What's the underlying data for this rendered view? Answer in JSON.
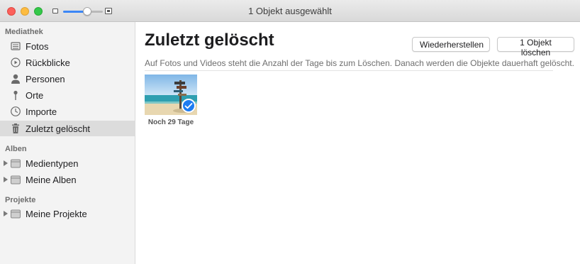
{
  "window": {
    "title": "1 Objekt ausgewählt",
    "zoom_level": 0.6
  },
  "sidebar": {
    "sections": [
      {
        "header": "Mediathek"
      },
      {
        "header": "Alben"
      },
      {
        "header": "Projekte"
      }
    ],
    "library_items": [
      {
        "label": "Fotos",
        "icon": "photos-icon"
      },
      {
        "label": "Rückblicke",
        "icon": "memories-icon"
      },
      {
        "label": "Personen",
        "icon": "person-icon"
      },
      {
        "label": "Orte",
        "icon": "pin-icon"
      },
      {
        "label": "Importe",
        "icon": "clock-icon"
      },
      {
        "label": "Zuletzt gelöscht",
        "icon": "trash-icon",
        "selected": true
      }
    ],
    "album_items": [
      {
        "label": "Medientypen",
        "icon": "folder-icon"
      },
      {
        "label": "Meine Alben",
        "icon": "folder-icon"
      }
    ],
    "project_items": [
      {
        "label": "Meine Projekte",
        "icon": "folder-icon"
      }
    ]
  },
  "main": {
    "title": "Zuletzt gelöscht",
    "restore_button": "Wiederherstellen",
    "delete_button": "1 Objekt löschen",
    "description": "Auf Fotos und Videos steht die Anzahl der Tage bis zum Löschen. Danach werden die Objekte dauerhaft gelöscht.",
    "items": [
      {
        "caption": "Noch 29 Tage",
        "selected": true
      }
    ]
  },
  "colors": {
    "accent": "#1e7cf2",
    "selection": "#dcdcdc"
  }
}
